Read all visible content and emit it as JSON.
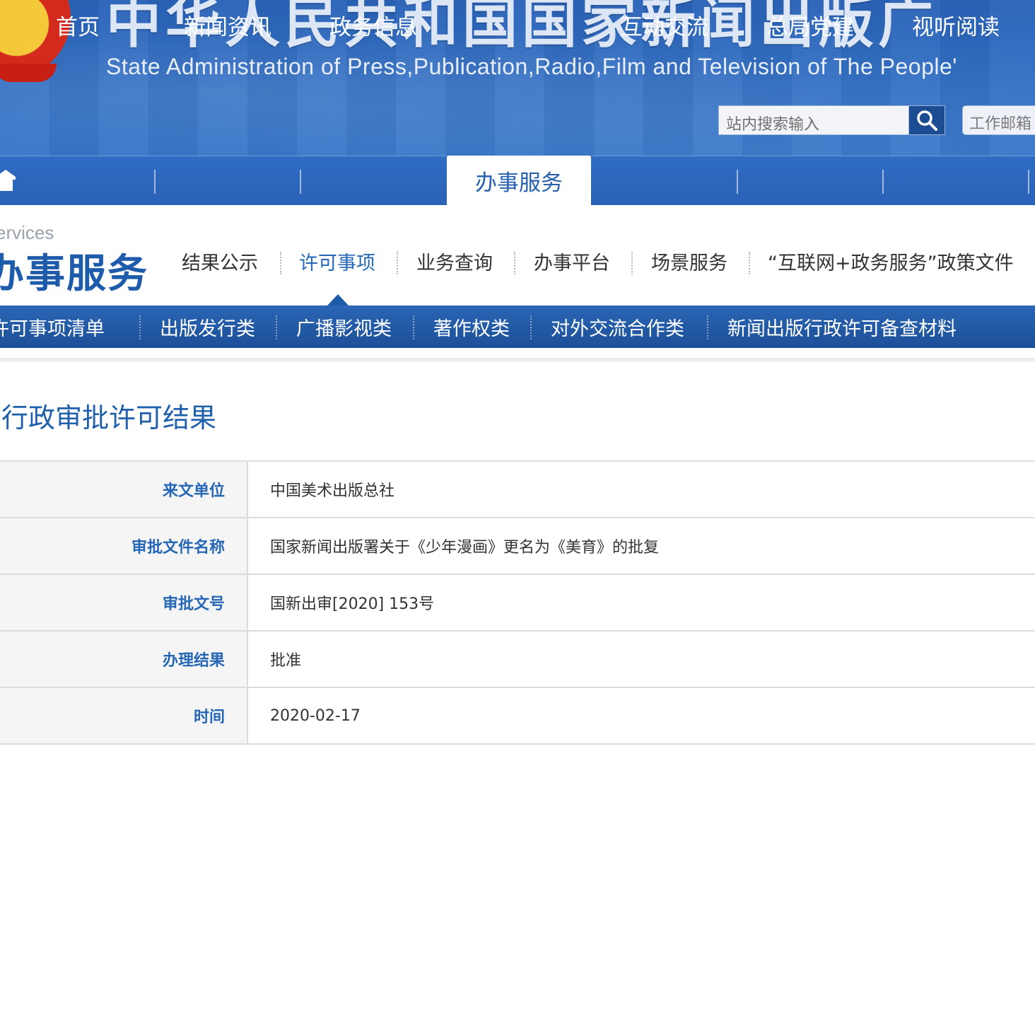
{
  "header": {
    "title": "中华人民共和国国家新闻出版广",
    "subtitle": "State Administration of Press,Publication,Radio,Film and Television of The People'",
    "search_placeholder": "站内搜索输入",
    "mail_label": "工作邮箱"
  },
  "main_nav": {
    "items": [
      {
        "label": "首页"
      },
      {
        "label": "新闻资讯"
      },
      {
        "label": "政务信息"
      },
      {
        "label": "办事服务"
      },
      {
        "label": "互动交流"
      },
      {
        "label": "总局党建"
      },
      {
        "label": "视听阅读"
      }
    ],
    "active_index": 3
  },
  "section": {
    "label_en": "ervices",
    "label_cn": "办事服务",
    "sub_nav": [
      {
        "label": "结果公示"
      },
      {
        "label": "许可事项"
      },
      {
        "label": "业务查询"
      },
      {
        "label": "办事平台"
      },
      {
        "label": "场景服务"
      },
      {
        "label": "“互联网+政务服务”政策文件"
      }
    ],
    "active_index": 1
  },
  "categories": [
    {
      "label": "许可事项清单"
    },
    {
      "label": "出版发行类"
    },
    {
      "label": "广播影视类"
    },
    {
      "label": "著作权类"
    },
    {
      "label": "对外交流合作类"
    },
    {
      "label": "新闻出版行政许可备查材料"
    }
  ],
  "page_title": "行政审批许可结果",
  "details": [
    {
      "label": "来文单位",
      "value": "中国美术出版总社"
    },
    {
      "label": "审批文件名称",
      "value": "国家新闻出版署关于《少年漫画》更名为《美育》的批复"
    },
    {
      "label": "审批文号",
      "value": "国新出审[2020] 153号"
    },
    {
      "label": "办理结果",
      "value": "批准"
    },
    {
      "label": "时间",
      "value": "2020-02-17"
    }
  ],
  "colors": {
    "brand_blue": "#2a62b6",
    "accent_blue": "#2566b5",
    "emblem_red": "#d42a1e",
    "emblem_gold": "#f3c93a"
  },
  "icons": {
    "search": "search-icon",
    "home": "home-icon",
    "emblem": "national-emblem-icon"
  }
}
